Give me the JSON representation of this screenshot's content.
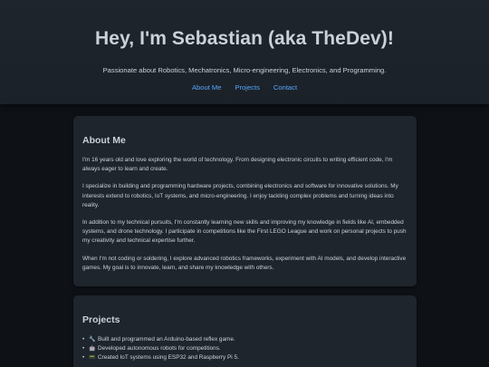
{
  "header": {
    "title": "Hey, I'm Sebastian (aka TheDev)!",
    "tagline": "Passionate about Robotics, Mechatronics, Micro-engineering, Electronics, and Programming.",
    "nav": [
      "About Me",
      "Projects",
      "Contact"
    ]
  },
  "about": {
    "heading": "About Me",
    "paragraphs": [
      "I'm 16 years old and love exploring the world of technology. From designing electronic circuits to writing efficient code, I'm always eager to learn and create.",
      "I specialize in building and programming hardware projects, combining electronics and software for innovative solutions. My interests extend to robotics, IoT systems, and micro-engineering. I enjoy tackling complex problems and turning ideas into reality.",
      "In addition to my technical pursuits, I'm constantly learning new skills and improving my knowledge in fields like AI, embedded systems, and drone technology. I participate in competitions like the First LEGO League and work on personal projects to push my creativity and technical expertise further.",
      "When I'm not coding or soldering, I explore advanced robotics frameworks, experiment with AI models, and develop interactive games. My goal is to innovate, learn, and share my knowledge with others."
    ]
  },
  "projects": {
    "heading": "Projects",
    "items": [
      {
        "icon": "🔧",
        "text": "Built and programmed an Arduino-based reflex game."
      },
      {
        "icon": "🤖",
        "text": "Developed autonomous robots for competitions."
      },
      {
        "icon": "📟",
        "text": "Created IoT systems using ESP32 and Raspberry Pi 5."
      }
    ]
  }
}
